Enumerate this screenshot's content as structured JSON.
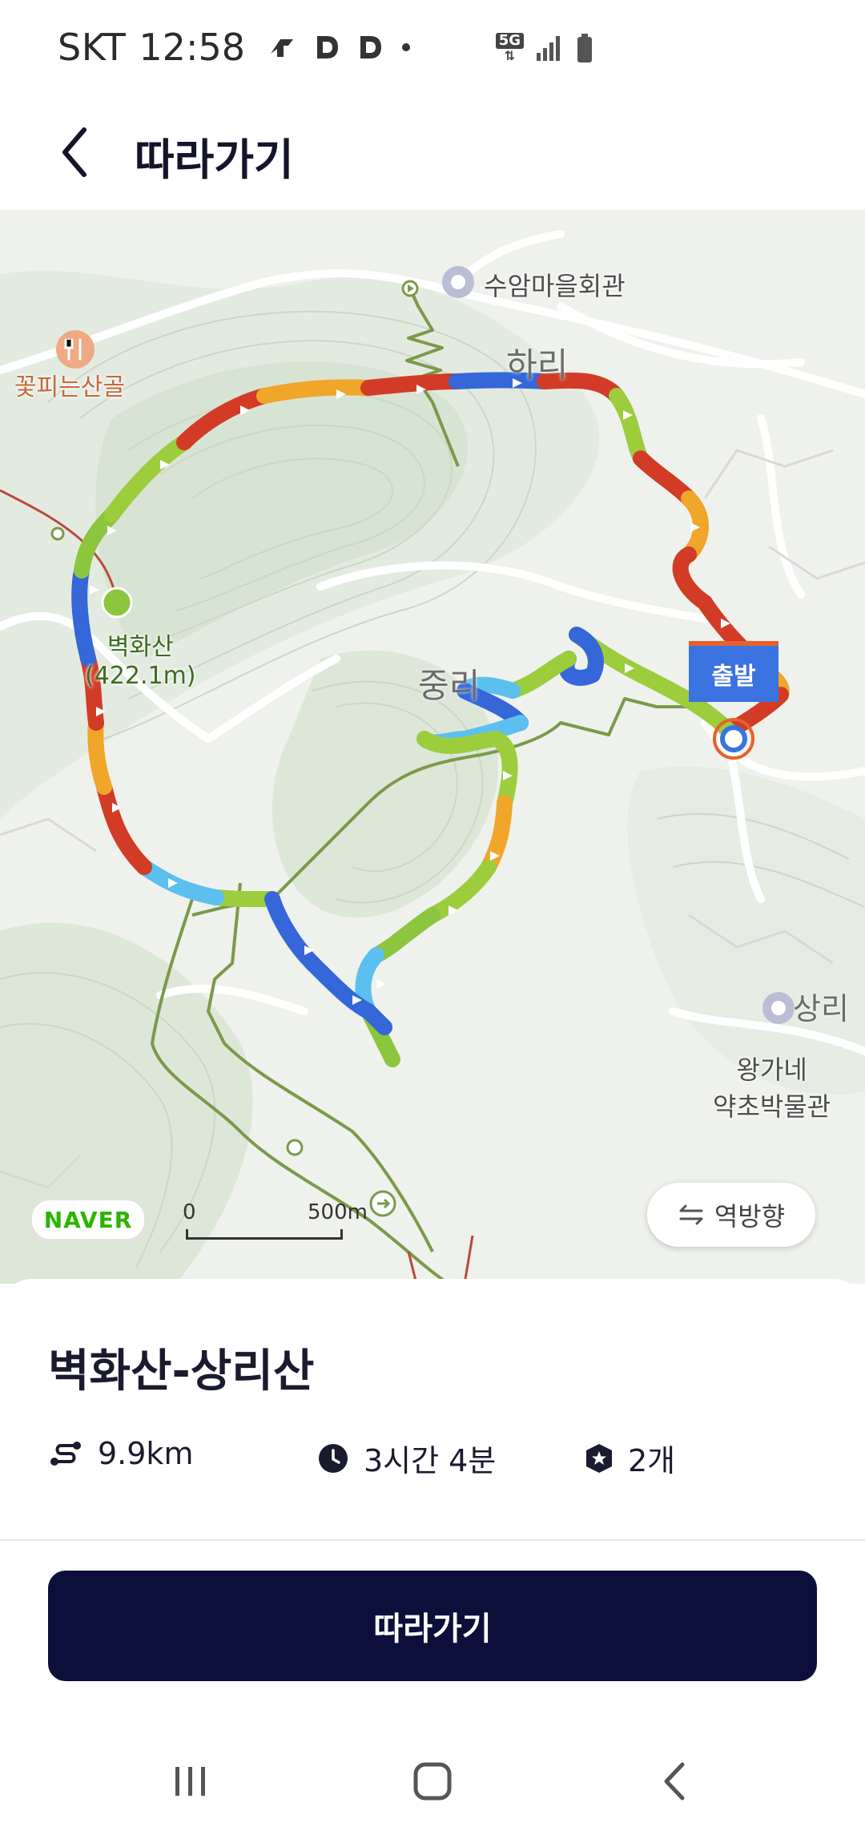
{
  "status_bar": {
    "carrier": "SKT",
    "time": "12:58",
    "network": "5G"
  },
  "header": {
    "title": "따라가기"
  },
  "map": {
    "labels": {
      "village_hall": "수암마을회관",
      "hari": "하리",
      "flower_valley": "꽃피는산골",
      "peak_name": "벽화산",
      "peak_height": "(422.1m)",
      "jungri": "중리",
      "sangri": "상리",
      "museum_line1": "왕가네",
      "museum_line2": "약초박물관"
    },
    "start_marker": "출발",
    "provider": "NAVER",
    "scale": {
      "zero": "0",
      "distance": "500m"
    },
    "reverse_button": "역방향"
  },
  "route": {
    "name": "벽화산-상리산",
    "distance": "9.9km",
    "duration": "3시간 4분",
    "peaks": "2개"
  },
  "actions": {
    "follow": "따라가기"
  },
  "colors": {
    "accent": "#0b0f3a",
    "start_marker": "#3a73e0",
    "trail": "#7a9a4a"
  }
}
